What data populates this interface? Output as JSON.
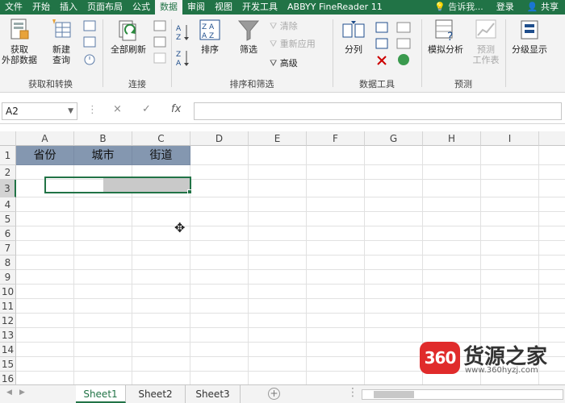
{
  "tabs": [
    "文件",
    "开始",
    "插入",
    "页面布局",
    "公式",
    "数据",
    "审阅",
    "视图",
    "开发工具",
    "ABBYY FineReader 11"
  ],
  "active_tab": "数据",
  "tell_me": "告诉我...",
  "login": "登录",
  "share": "共享",
  "ribbon": {
    "get_external": [
      "获取",
      "外部数据"
    ],
    "new_query": [
      "新建",
      "查询"
    ],
    "group_get": "获取和转换",
    "refresh_all": "全部刷新",
    "group_connections": "连接",
    "sort": "排序",
    "filter": "筛选",
    "clear": "清除",
    "reapply": "重新应用",
    "advanced": "高级",
    "group_sort_filter": "排序和筛选",
    "split": "分列",
    "group_data_tools": "数据工具",
    "what_if": "模拟分析",
    "forecast": [
      "预测",
      "工作表"
    ],
    "group_forecast": "预测",
    "outline": "分级显示"
  },
  "formula_bar": {
    "name_box": "A2",
    "fx": "fx",
    "cancel": "×",
    "enter": "✓"
  },
  "columns": [
    "A",
    "B",
    "C",
    "D",
    "E",
    "F",
    "G",
    "H",
    "I"
  ],
  "rows": [
    "1",
    "2",
    "3",
    "4",
    "5",
    "6",
    "7",
    "8",
    "9",
    "10",
    "11",
    "12",
    "13",
    "14",
    "15",
    "16"
  ],
  "header_cells": [
    "省份",
    "城市",
    "街道"
  ],
  "sheets": [
    "Sheet1",
    "Sheet2",
    "Sheet3"
  ],
  "active_sheet": "Sheet1",
  "watermark": {
    "logo": "360",
    "name": "货源之家",
    "url": "www.360hyzj.com"
  },
  "colors": {
    "excel_green": "#217346",
    "header_fill": "#8497b0",
    "selection_fill": "#c9c9c9"
  }
}
